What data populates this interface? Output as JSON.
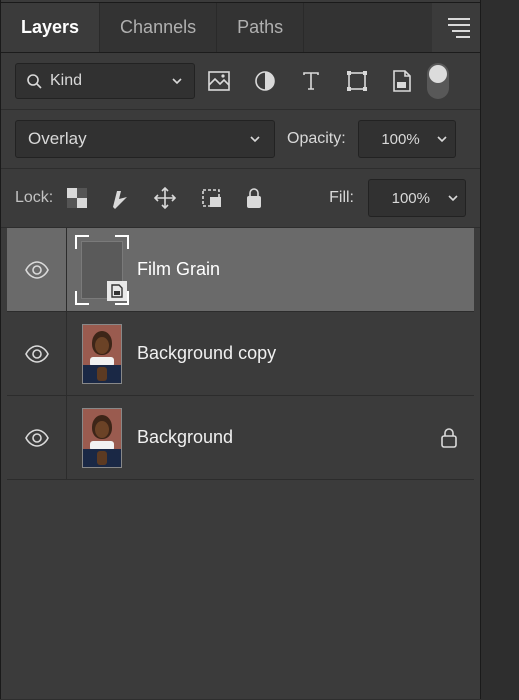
{
  "tabs": {
    "layers": "Layers",
    "channels": "Channels",
    "paths": "Paths"
  },
  "filter": {
    "kind": "Kind"
  },
  "blend": {
    "mode": "Overlay",
    "opacity_label": "Opacity:",
    "opacity_value": "100%"
  },
  "lock": {
    "label": "Lock:",
    "fill_label": "Fill:",
    "fill_value": "100%"
  },
  "layers": [
    {
      "name": "Film Grain",
      "type": "smart",
      "selected": true,
      "locked": false
    },
    {
      "name": "Background copy",
      "type": "image",
      "selected": false,
      "locked": false
    },
    {
      "name": "Background",
      "type": "image",
      "selected": false,
      "locked": true
    }
  ]
}
